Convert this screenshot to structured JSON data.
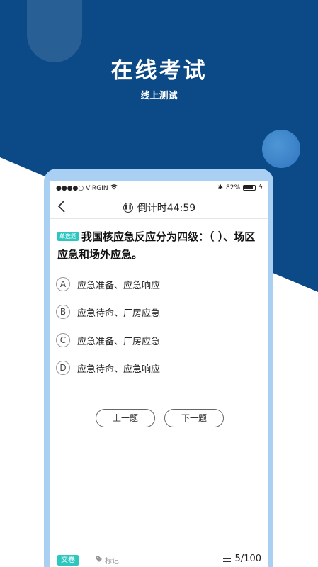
{
  "colors": {
    "primary": "#0b4a87",
    "accent": "#2ec7c0",
    "frame": "#a9d0f2"
  },
  "hero": {
    "title": "在线考试",
    "subtitle": "线上测试"
  },
  "status_bar": {
    "carrier": "●●●●○ VIRGIN",
    "wifi_icon": "wifi-icon",
    "battery": "82%"
  },
  "nav": {
    "back_icon": "chevron-left-icon",
    "timer": "倒计时44:59"
  },
  "question": {
    "tag": "单选题",
    "text": "我国核应急反应分为四级：（ ）、场区应急和场外应急。",
    "options": [
      {
        "letter": "A",
        "text": "应急准备、应急响应"
      },
      {
        "letter": "B",
        "text": "应急待命、厂房应急"
      },
      {
        "letter": "C",
        "text": "应急准备、厂房应急"
      },
      {
        "letter": "D",
        "text": "应急待命、应急响应"
      }
    ]
  },
  "buttons": {
    "prev": "上一题",
    "next": "下一题"
  },
  "bottom": {
    "submit": "交卷",
    "mark": "标记",
    "progress": "5/100"
  }
}
